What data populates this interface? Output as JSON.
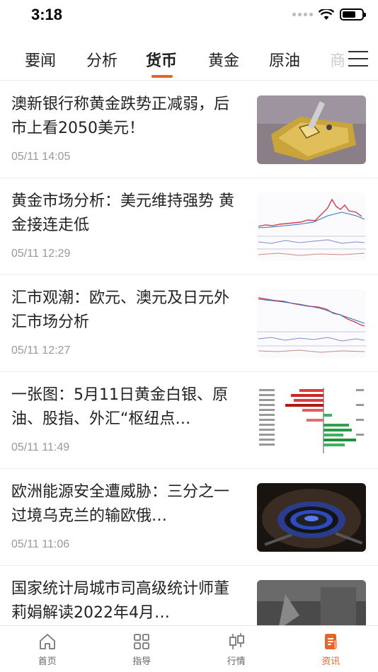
{
  "status": {
    "time": "3:18"
  },
  "tabs": [
    {
      "label": "要闻"
    },
    {
      "label": "分析"
    },
    {
      "label": "货币"
    },
    {
      "label": "黄金"
    },
    {
      "label": "原油"
    },
    {
      "label": "商"
    }
  ],
  "active_tab": "货币",
  "news": [
    {
      "title": "澳新银行称黄金跌势正减弱，后市上看2050美元！",
      "time": "05/11 14:05",
      "thumb": "gold-bar"
    },
    {
      "title": "黄金市场分析：美元维持强势 黄金接连走低",
      "time": "05/11 12:29",
      "thumb": "chart-up"
    },
    {
      "title": "汇市观潮：欧元、澳元及日元外汇市场分析",
      "time": "05/11 12:27",
      "thumb": "chart-down"
    },
    {
      "title": "一张图：5月11日黄金白银、原油、股指、外汇“枢纽点…",
      "time": "05/11 11:49",
      "thumb": "pivot-table"
    },
    {
      "title": "欧洲能源安全遭威胁：三分之一过境乌克兰的输欧俄…",
      "time": "05/11 11:06",
      "thumb": "gas-flame"
    },
    {
      "title": "国家统计局城市司高级统计师董莉娟解读2022年4月…",
      "time": "",
      "thumb": "dark"
    }
  ],
  "bottom_nav": [
    {
      "label": "首页",
      "icon": "home-icon"
    },
    {
      "label": "指导",
      "icon": "grid-icon"
    },
    {
      "label": "行情",
      "icon": "candlestick-icon"
    },
    {
      "label": "资讯",
      "icon": "news-icon",
      "active": true
    }
  ],
  "colors": {
    "accent": "#e8632a",
    "text": "#222222",
    "muted": "#999999"
  }
}
